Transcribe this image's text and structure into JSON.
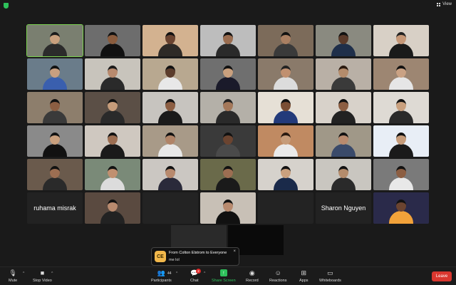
{
  "topbar": {
    "view_label": "View"
  },
  "tiles": [
    {
      "row": 0,
      "col": 0,
      "active": true,
      "bg": "#7a7f70",
      "skin": "#c9a07e",
      "shirt": "#2b2b2b",
      "hair": "#1a1a1a"
    },
    {
      "row": 0,
      "col": 1,
      "bg": "#6d6d6d",
      "skin": "#8a5c3e",
      "shirt": "#111",
      "hair": "#111"
    },
    {
      "row": 0,
      "col": 2,
      "bg": "#d3b290",
      "skin": "#6b4430",
      "shirt": "#2e2a26",
      "hair": "#111"
    },
    {
      "row": 0,
      "col": 3,
      "bg": "#bdbdbd",
      "skin": "#9a6d50",
      "shirt": "#2a2a2a",
      "hair": "#111"
    },
    {
      "row": 0,
      "col": 4,
      "bg": "#7c6b5a",
      "skin": "#a97f62",
      "shirt": "#3a3a3a",
      "hair": "#111"
    },
    {
      "row": 0,
      "col": 5,
      "bg": "#8a8a80",
      "skin": "#5a3a2a",
      "shirt": "#1f2f4a",
      "hair": "#111"
    },
    {
      "row": 0,
      "col": 6,
      "bg": "#d8d0c6",
      "skin": "#c69878",
      "shirt": "#1a1a1a",
      "hair": "#222"
    },
    {
      "row": 1,
      "col": 0,
      "bg": "#6a7c8a",
      "skin": "#c89f80",
      "shirt": "#3a5fae",
      "hair": "#111"
    },
    {
      "row": 1,
      "col": 1,
      "bg": "#c8c4bc",
      "skin": "#b88a6e",
      "shirt": "#2a2a2a",
      "hair": "#1a1a1a"
    },
    {
      "row": 1,
      "col": 2,
      "bg": "#b8a890",
      "skin": "#5c3d2c",
      "shirt": "#e8e8e8",
      "hair": "#111"
    },
    {
      "row": 1,
      "col": 3,
      "bg": "#6f6f6f",
      "skin": "#c9a07e",
      "shirt": "#1a1a2a",
      "hair": "#111"
    },
    {
      "row": 1,
      "col": 4,
      "bg": "#8a7a6a",
      "skin": "#c09070",
      "shirt": "#dcdcdc",
      "hair": "#222"
    },
    {
      "row": 1,
      "col": 5,
      "bg": "#b9b0a6",
      "skin": "#b48c6c",
      "shirt": "#3a3a3a",
      "hair": "#2a1a10"
    },
    {
      "row": 1,
      "col": 6,
      "bg": "#9d8672",
      "skin": "#caa284",
      "shirt": "#e6e6e6",
      "hair": "#111"
    },
    {
      "row": 2,
      "col": 0,
      "bg": "#8d7e6c",
      "skin": "#8c5e42",
      "shirt": "#3a3a3a",
      "hair": "#111"
    },
    {
      "row": 2,
      "col": 1,
      "bg": "#5b4f46",
      "skin": "#c69c7a",
      "shirt": "#2a2a2a",
      "hair": "#111"
    },
    {
      "row": 2,
      "col": 2,
      "bg": "#c7c4bf",
      "skin": "#8c5e42",
      "shirt": "#1a1a1a",
      "hair": "#111"
    },
    {
      "row": 2,
      "col": 3,
      "bg": "#b4b0a8",
      "skin": "#a4785a",
      "shirt": "#2a2a2a",
      "hair": "#222"
    },
    {
      "row": 2,
      "col": 4,
      "bg": "#e6e0d6",
      "skin": "#7a4e34",
      "shirt": "#233a7a",
      "hair": "#111"
    },
    {
      "row": 2,
      "col": 5,
      "bg": "#d8d2ca",
      "skin": "#8c5e42",
      "shirt": "#222",
      "hair": "#111"
    },
    {
      "row": 2,
      "col": 6,
      "bg": "#dedad4",
      "skin": "#c9a07e",
      "shirt": "#2a2a2a",
      "hair": "#111"
    },
    {
      "row": 3,
      "col": 0,
      "bg": "#8a8a8a",
      "skin": "#c9a07e",
      "shirt": "#111",
      "hair": "#111"
    },
    {
      "row": 3,
      "col": 1,
      "bg": "#cfc8c0",
      "skin": "#9c6e52",
      "shirt": "#1a1a1a",
      "hair": "#111"
    },
    {
      "row": 3,
      "col": 2,
      "bg": "#a89a88",
      "skin": "#b08468",
      "shirt": "#e8e8e8",
      "hair": "#111"
    },
    {
      "row": 3,
      "col": 3,
      "bg": "#3a3a3a",
      "skin": "#6b4430",
      "shirt": "#4a4a4a",
      "hair": "#111"
    },
    {
      "row": 3,
      "col": 4,
      "bg": "#c08a62",
      "skin": "#c69c7a",
      "shirt": "#eaeaea",
      "hair": "#2a1a10"
    },
    {
      "row": 3,
      "col": 5,
      "bg": "#a09888",
      "skin": "#b88a6e",
      "shirt": "#3a4a6a",
      "hair": "#111"
    },
    {
      "row": 3,
      "col": 6,
      "bg": "#e8eef6",
      "skin": "#c69c7a",
      "shirt": "#1a1a1a",
      "hair": "#111"
    },
    {
      "row": 4,
      "col": 0,
      "bg": "#6a5a4c",
      "skin": "#9c6e52",
      "shirt": "#2a2a2a",
      "hair": "#111"
    },
    {
      "row": 4,
      "col": 1,
      "bg": "#7a8a78",
      "skin": "#c09070",
      "shirt": "#dcdcdc",
      "hair": "#111"
    },
    {
      "row": 4,
      "col": 2,
      "bg": "#cbc7c2",
      "skin": "#b88a6e",
      "shirt": "#2a2a3a",
      "hair": "#111"
    },
    {
      "row": 4,
      "col": 3,
      "bg": "#6a6a4a",
      "skin": "#9c6e52",
      "shirt": "#1a1a1a",
      "hair": "#111"
    },
    {
      "row": 4,
      "col": 4,
      "bg": "#d6d2cc",
      "skin": "#c9a07e",
      "shirt": "#1a2a4a",
      "hair": "#111"
    },
    {
      "row": 4,
      "col": 5,
      "bg": "#c9c6c0",
      "skin": "#b48c6c",
      "shirt": "#2a2a2a",
      "hair": "#111"
    },
    {
      "row": 4,
      "col": 6,
      "bg": "#7a7a7a",
      "skin": "#8c5e42",
      "shirt": "#e8e8e8",
      "hair": "#111"
    }
  ],
  "name_tiles": [
    {
      "row": 5,
      "col": 0,
      "name": "ruhama misrak"
    },
    {
      "row": 5,
      "col": 5,
      "name": "Sharon Nguyen"
    }
  ],
  "video_tiles_row5": [
    {
      "row": 5,
      "col": 1,
      "bg": "#5a4a40",
      "skin": "#b88a6e",
      "shirt": "#222",
      "hair": "#111"
    },
    {
      "row": 5,
      "col": 3,
      "bg": "#c8c0b6",
      "skin": "#b88a6e",
      "shirt": "#111",
      "hair": "#111"
    },
    {
      "row": 5,
      "col": 6,
      "bg": "#2a2a4a",
      "skin": "#6b4430",
      "shirt": "#f2a23a",
      "hair": "#111"
    }
  ],
  "chat_popup": {
    "avatar_initials": "CE",
    "from": "From Colton Elstrom to Everyone",
    "message": "me lol",
    "close": "×"
  },
  "toolbar": {
    "mute": "Mute",
    "stop_video": "Stop Video",
    "participants": "Participants",
    "participants_count": "44",
    "chat": "Chat",
    "chat_badge": "2",
    "share_screen": "Share Screen",
    "record": "Record",
    "reactions": "Reactions",
    "apps": "Apps",
    "whiteboards": "Whiteboards",
    "leave": "Leave"
  },
  "colors": {
    "accent_green": "#2ec15b",
    "leave_red": "#d9372f",
    "active_outline": "#7ad14f"
  }
}
